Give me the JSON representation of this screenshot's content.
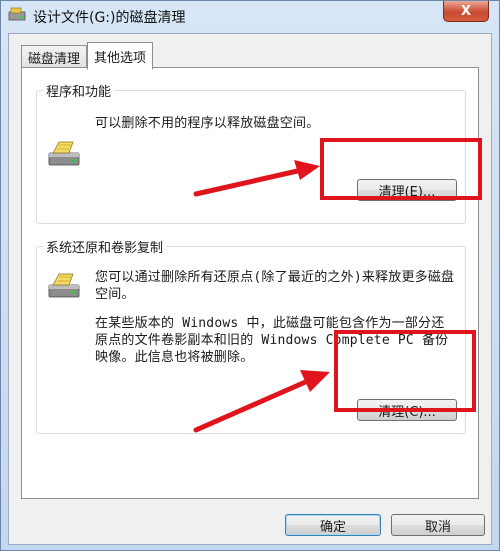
{
  "window": {
    "title": "设计文件(G:)的磁盘清理",
    "close_glyph": "X"
  },
  "tabs": [
    {
      "label": "磁盘清理",
      "active": false
    },
    {
      "label": "其他选项",
      "active": true
    }
  ],
  "programs": {
    "group_label": "程序和功能",
    "description": "可以删除不用的程序以释放磁盘空间。",
    "button_label": "清理(E)..."
  },
  "restore": {
    "group_label": "系统还原和卷影复制",
    "description_1": "您可以通过删除所有还原点(除了最近的之外)来释放更多磁盘空间。",
    "description_2": "在某些版本的 Windows 中，此磁盘可能包含作为一部分还原点的文件卷影副本和旧的 Windows Complete PC 备份映像。此信息也将被删除。",
    "button_label": "清理(C)..."
  },
  "footer": {
    "ok_label": "确定",
    "cancel_label": "取消"
  },
  "annotation": {
    "color": "#e0141c"
  }
}
